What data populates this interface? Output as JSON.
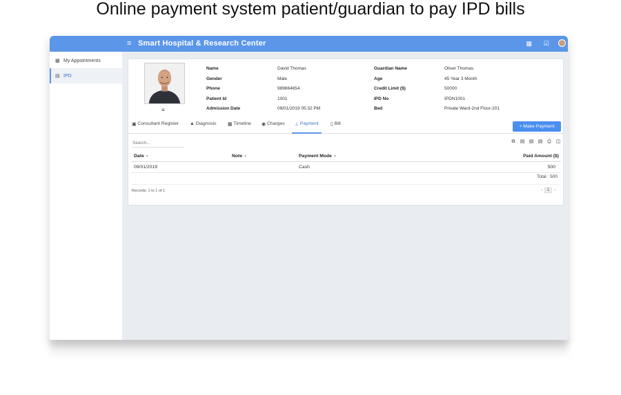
{
  "headline": "Online payment system patient/guardian to pay IPD bills",
  "topbar": {
    "menu_glyph": "≡",
    "brand": "Smart Hospital & Research Center",
    "icons": [
      "calendar-icon",
      "checkbox-icon",
      "user-avatar"
    ]
  },
  "sidebar": {
    "items": [
      {
        "label": "My Appointments",
        "icon": "hospital-icon"
      },
      {
        "label": "IPD",
        "icon": "bed-icon",
        "active": true
      }
    ]
  },
  "patient": {
    "left": [
      {
        "k": "Name",
        "v": "David Thomas"
      },
      {
        "k": "Gender",
        "v": "Male"
      },
      {
        "k": "Phone",
        "v": "989664654"
      },
      {
        "k": "Patient Id",
        "v": "1001"
      },
      {
        "k": "Admission Date",
        "v": "09/01/2019 05:32 PM"
      }
    ],
    "right": [
      {
        "k": "Guardian Name",
        "v": "Oliver Thomas"
      },
      {
        "k": "Age",
        "v": "45 Year 3 Month"
      },
      {
        "k": "Credit Limit ($)",
        "v": "50000"
      },
      {
        "k": "IPD No",
        "v": "IPDN1001"
      },
      {
        "k": "Bed",
        "v": "Private Ward-2nd Floor-201"
      }
    ],
    "photo_menu": "≡"
  },
  "tabs": [
    {
      "label": "Consultant Register",
      "icon": "book-icon"
    },
    {
      "label": "Diagnosis",
      "icon": "sitemap-icon"
    },
    {
      "label": "Timeline",
      "icon": "calendar-icon"
    },
    {
      "label": "Charges",
      "icon": "charges-icon"
    },
    {
      "label": "Payment",
      "icon": "payment-icon",
      "active": true
    },
    {
      "label": "Bill",
      "icon": "bill-icon"
    }
  ],
  "make_payment": "+ Make Payment",
  "search": {
    "placeholder": "Search..."
  },
  "tools": [
    "copy-icon",
    "excel-icon",
    "csv-icon",
    "pdf-icon",
    "print-icon",
    "columns-icon"
  ],
  "table": {
    "headers": [
      "Date",
      "Note",
      "Payment Mode",
      "Paid Amount ($)"
    ],
    "rows": [
      [
        "09/01/2019",
        "",
        "Cash",
        "500"
      ]
    ],
    "total": "Total : 500"
  },
  "records": "Records: 1 to 1 of 1",
  "pager": {
    "prev": "‹",
    "page": "1",
    "next": "›"
  },
  "colors": {
    "accent": "#5b96e8",
    "button": "#4a8ff0",
    "background": "#e9ecf1"
  }
}
